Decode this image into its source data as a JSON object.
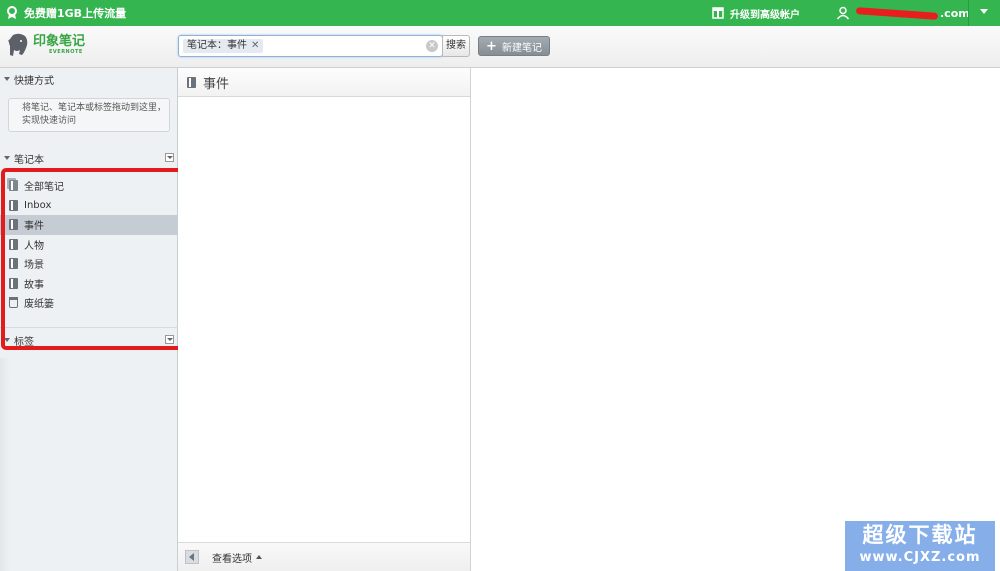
{
  "topbar": {
    "promo_text": "免费赠1GB上传流量",
    "upgrade_text": "升级到高级帐户",
    "user_email_suffix": ".com",
    "bg_color": "#35b54f"
  },
  "logo": {
    "name_cn": "印象笔记",
    "name_en": "EVERNOTE"
  },
  "search": {
    "filter_tag": "笔记本：事件",
    "filter_remove": "✕",
    "clear_glyph": "✕",
    "button_label": "搜索"
  },
  "toolbar": {
    "new_note_plus": "+",
    "new_note_label": "新建笔记"
  },
  "sidebar": {
    "shortcuts": {
      "title": "快捷方式",
      "hint": "将笔记、笔记本或标签拖动到这里，实现快速访问"
    },
    "notebooks": {
      "title": "笔记本",
      "items": [
        {
          "label": "全部笔记",
          "icon": "notebook-stack-icon"
        },
        {
          "label": "Inbox",
          "icon": "notebook-icon"
        },
        {
          "label": "事件",
          "icon": "notebook-icon",
          "selected": true
        },
        {
          "label": "人物",
          "icon": "notebook-icon"
        },
        {
          "label": "场景",
          "icon": "notebook-icon"
        },
        {
          "label": "故事",
          "icon": "notebook-icon"
        },
        {
          "label": "废纸篓",
          "icon": "trash-icon"
        }
      ]
    },
    "tags": {
      "title": "标签"
    }
  },
  "notelist": {
    "title": "事件",
    "view_options": "查看选项"
  },
  "watermark": {
    "cn": "超级下载站",
    "en": "www.CJXZ.com"
  },
  "colors": {
    "highlight_box": "#e31b1b",
    "selected_row": "#c6ccd3",
    "brand_green": "#36a543"
  }
}
